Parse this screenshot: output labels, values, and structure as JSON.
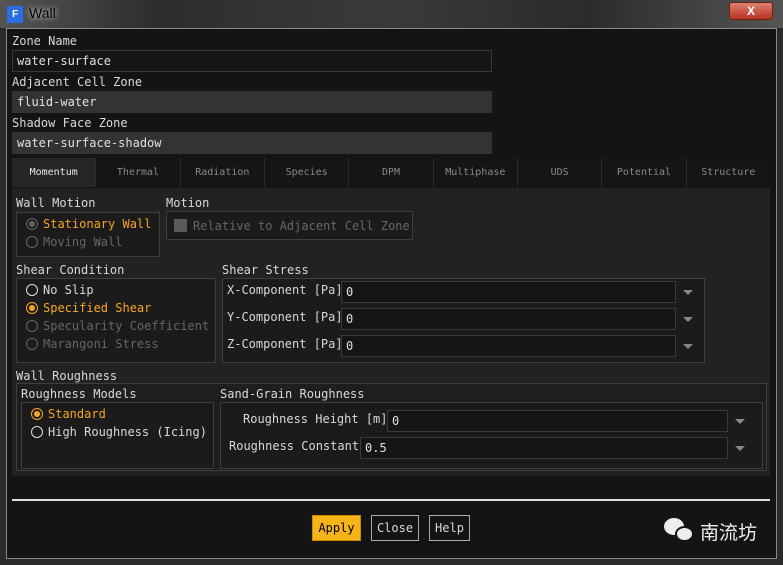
{
  "window": {
    "title": "Wall",
    "app_icon": "F",
    "close": "X"
  },
  "zone_name": {
    "label": "Zone Name",
    "value": "water-surface"
  },
  "adjacent": {
    "label": "Adjacent Cell Zone",
    "value": "fluid-water"
  },
  "shadow": {
    "label": "Shadow Face Zone",
    "value": "water-surface-shadow"
  },
  "tabs": [
    "Momentum",
    "Thermal",
    "Radiation",
    "Species",
    "DPM",
    "Multiphase",
    "UDS",
    "Potential",
    "Structure"
  ],
  "wall_motion": {
    "label": "Wall Motion",
    "options": [
      "Stationary Wall",
      "Moving Wall"
    ],
    "selected": "Stationary Wall"
  },
  "motion": {
    "label": "Motion",
    "checkbox": "Relative to Adjacent Cell Zone"
  },
  "shear_condition": {
    "label": "Shear Condition",
    "options": [
      "No Slip",
      "Specified Shear",
      "Specularity Coefficient",
      "Marangoni Stress"
    ],
    "selected": "Specified Shear"
  },
  "shear_stress": {
    "label": "Shear Stress",
    "rows": [
      {
        "label": "X-Component [Pa]",
        "value": "0"
      },
      {
        "label": "Y-Component [Pa]",
        "value": "0"
      },
      {
        "label": "Z-Component [Pa]",
        "value": "0"
      }
    ]
  },
  "wall_roughness": {
    "label": "Wall Roughness",
    "models_label": "Roughness Models",
    "models": [
      "Standard",
      "High Roughness (Icing)"
    ],
    "selected": "Standard",
    "sand_label": "Sand-Grain Roughness",
    "height": {
      "label": "Roughness Height [m]",
      "value": "0"
    },
    "constant": {
      "label": "Roughness Constant",
      "value": "0.5"
    }
  },
  "buttons": {
    "apply": "Apply",
    "close": "Close",
    "help": "Help"
  },
  "watermark": "南流坊"
}
